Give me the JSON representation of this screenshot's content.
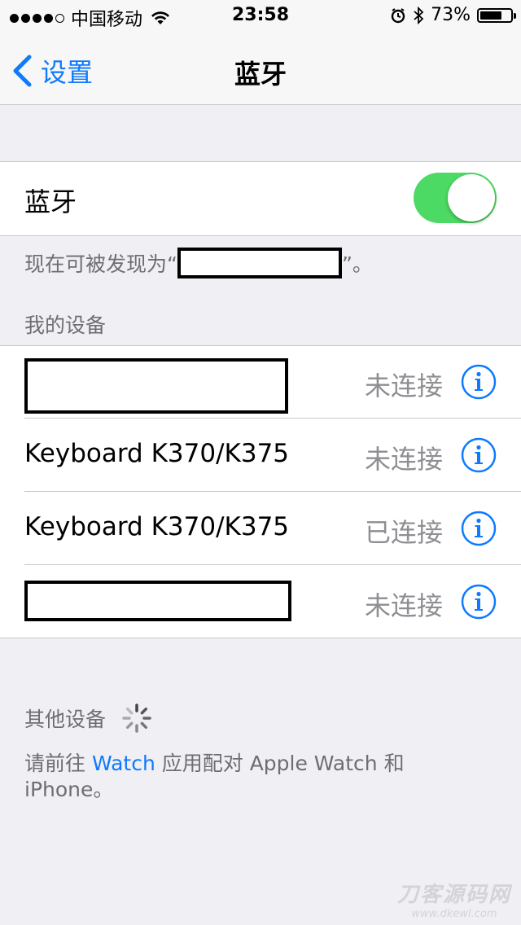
{
  "status_bar": {
    "carrier": "中国移动",
    "time": "23:58",
    "battery_percent": "73%",
    "battery_level": 0.73,
    "signal_bars_filled": 4,
    "signal_bars_total": 5,
    "icons": [
      "wifi-icon",
      "alarm-icon",
      "bluetooth-icon",
      "battery-icon"
    ]
  },
  "nav": {
    "back_label": "设置",
    "title": "蓝牙"
  },
  "bluetooth": {
    "label": "蓝牙",
    "enabled": true,
    "discoverable_prefix": "现在可被发现为“",
    "discoverable_suffix": "”。"
  },
  "my_devices": {
    "header": "我的设备",
    "items": [
      {
        "name": "",
        "redacted": true,
        "status": "未连接"
      },
      {
        "name": "Keyboard K370/K375",
        "redacted": false,
        "status": "未连接"
      },
      {
        "name": "Keyboard K370/K375",
        "redacted": false,
        "status": "已连接"
      },
      {
        "name": "",
        "redacted": true,
        "status": "未连接"
      }
    ]
  },
  "other_devices": {
    "header": "其他设备",
    "note_prefix": "请前往 ",
    "note_link": "Watch",
    "note_suffix": " 应用配对 Apple Watch 和 iPhone。"
  },
  "watermark": {
    "title": "刀客源码网",
    "url": "www.dkewl.com"
  },
  "colors": {
    "accent": "#0e7afe",
    "switch_on": "#4cd964",
    "background": "#efeff4",
    "secondary_text": "#8e8e93"
  }
}
